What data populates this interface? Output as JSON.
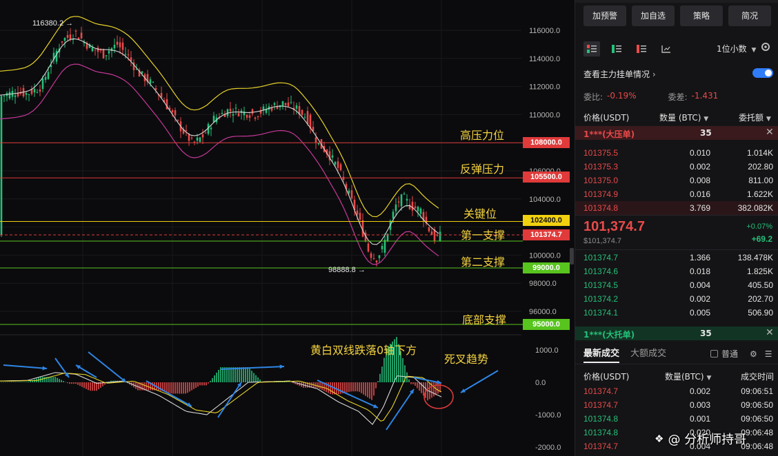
{
  "chart": {
    "price_axis_ticks": [
      "116000.0",
      "114000.0",
      "112000.0",
      "110000.0",
      "106000.0",
      "104000.0",
      "100000.0",
      "98000.0",
      "96000.0"
    ],
    "macd_axis_ticks": [
      "1000.0",
      "0.0",
      "-1000.0",
      "-2000.0"
    ],
    "high_marker": "116380.2 →",
    "low_marker": "98888.8 →",
    "levels": [
      {
        "label": "高压力位",
        "tag": "108000.0",
        "color": "#e03a3a"
      },
      {
        "label": "反弹压力",
        "tag": "105500.0",
        "color": "#e03a3a"
      },
      {
        "label": "关键位",
        "tag": "102400.0",
        "color": "#f2d10f"
      },
      {
        "label": "第一支撑",
        "tag": "101374.7",
        "color": "#e03a3a"
      },
      {
        "label": "第二支撑",
        "tag": "99000.0",
        "color": "#58c41e"
      },
      {
        "label": "底部支撑",
        "tag": "95000.0",
        "color": "#58c41e"
      }
    ],
    "macd_annotation_1": "黄白双线跌落0轴下方",
    "macd_annotation_2": "死叉趋势",
    "colors": {
      "up": "#25c07a",
      "down": "#e94a4a",
      "yellow_band": "#e8d32a",
      "white_line": "#d8d8d8",
      "magenta_band": "#c8389a",
      "arrow": "#2f86e6"
    }
  },
  "panel": {
    "buttons": [
      "加预警",
      "加自选",
      "策略",
      "简况"
    ],
    "view_icons": [
      "orderbook-both-icon",
      "orderbook-bids-icon",
      "orderbook-asks-icon",
      "depth-chart-icon"
    ],
    "decimal_select": "1位小数",
    "main_force_label": "查看主力挂单情况",
    "ratio_label": "委比:",
    "ratio_value": "-0.19%",
    "diff_label": "委差:",
    "diff_value": "-1.431",
    "col_price": "价格(USDT)",
    "col_qty": "数量 (BTC)",
    "col_total": "委托额",
    "ask_banner": {
      "name": "1***(大压单)",
      "qty": "35"
    },
    "asks": [
      {
        "price": "101375.5",
        "qty": "0.010",
        "total": "1.014K"
      },
      {
        "price": "101375.3",
        "qty": "0.002",
        "total": "202.80"
      },
      {
        "price": "101375.0",
        "qty": "0.008",
        "total": "811.00"
      },
      {
        "price": "101374.9",
        "qty": "0.016",
        "total": "1.622K"
      },
      {
        "price": "101374.8",
        "qty": "3.769",
        "total": "382.082K"
      }
    ],
    "last_price": "101,374.7",
    "last_usd": "$101,374.7",
    "change_pct": "+0.07%",
    "change_abs": "+69.2",
    "bids": [
      {
        "price": "101374.7",
        "qty": "1.366",
        "total": "138.478K"
      },
      {
        "price": "101374.6",
        "qty": "0.018",
        "total": "1.825K"
      },
      {
        "price": "101374.5",
        "qty": "0.004",
        "total": "405.50"
      },
      {
        "price": "101374.2",
        "qty": "0.002",
        "total": "202.70"
      },
      {
        "price": "101374.1",
        "qty": "0.005",
        "total": "506.90"
      }
    ],
    "bid_banner": {
      "name": "1***(大托单)",
      "qty": "35"
    },
    "tab_latest": "最新成交",
    "tab_large": "大额成交",
    "common_label": "普通",
    "trade_col_price": "价格(USDT)",
    "trade_col_qty": "数量(BTC)",
    "trade_col_time": "成交时间",
    "trades": [
      {
        "price": "101374.7",
        "qty": "0.002",
        "time": "09:06:51",
        "side": "sell"
      },
      {
        "price": "101374.7",
        "qty": "0.003",
        "time": "09:06:50",
        "side": "sell"
      },
      {
        "price": "101374.8",
        "qty": "0.001",
        "time": "09:06:50",
        "side": "buy"
      },
      {
        "price": "101374.8",
        "qty": "0.020",
        "time": "09:06:48",
        "side": "buy"
      },
      {
        "price": "101374.7",
        "qty": "0.004",
        "time": "09:06:48",
        "side": "sell"
      }
    ],
    "watermark": "@ 分析师持哥"
  }
}
